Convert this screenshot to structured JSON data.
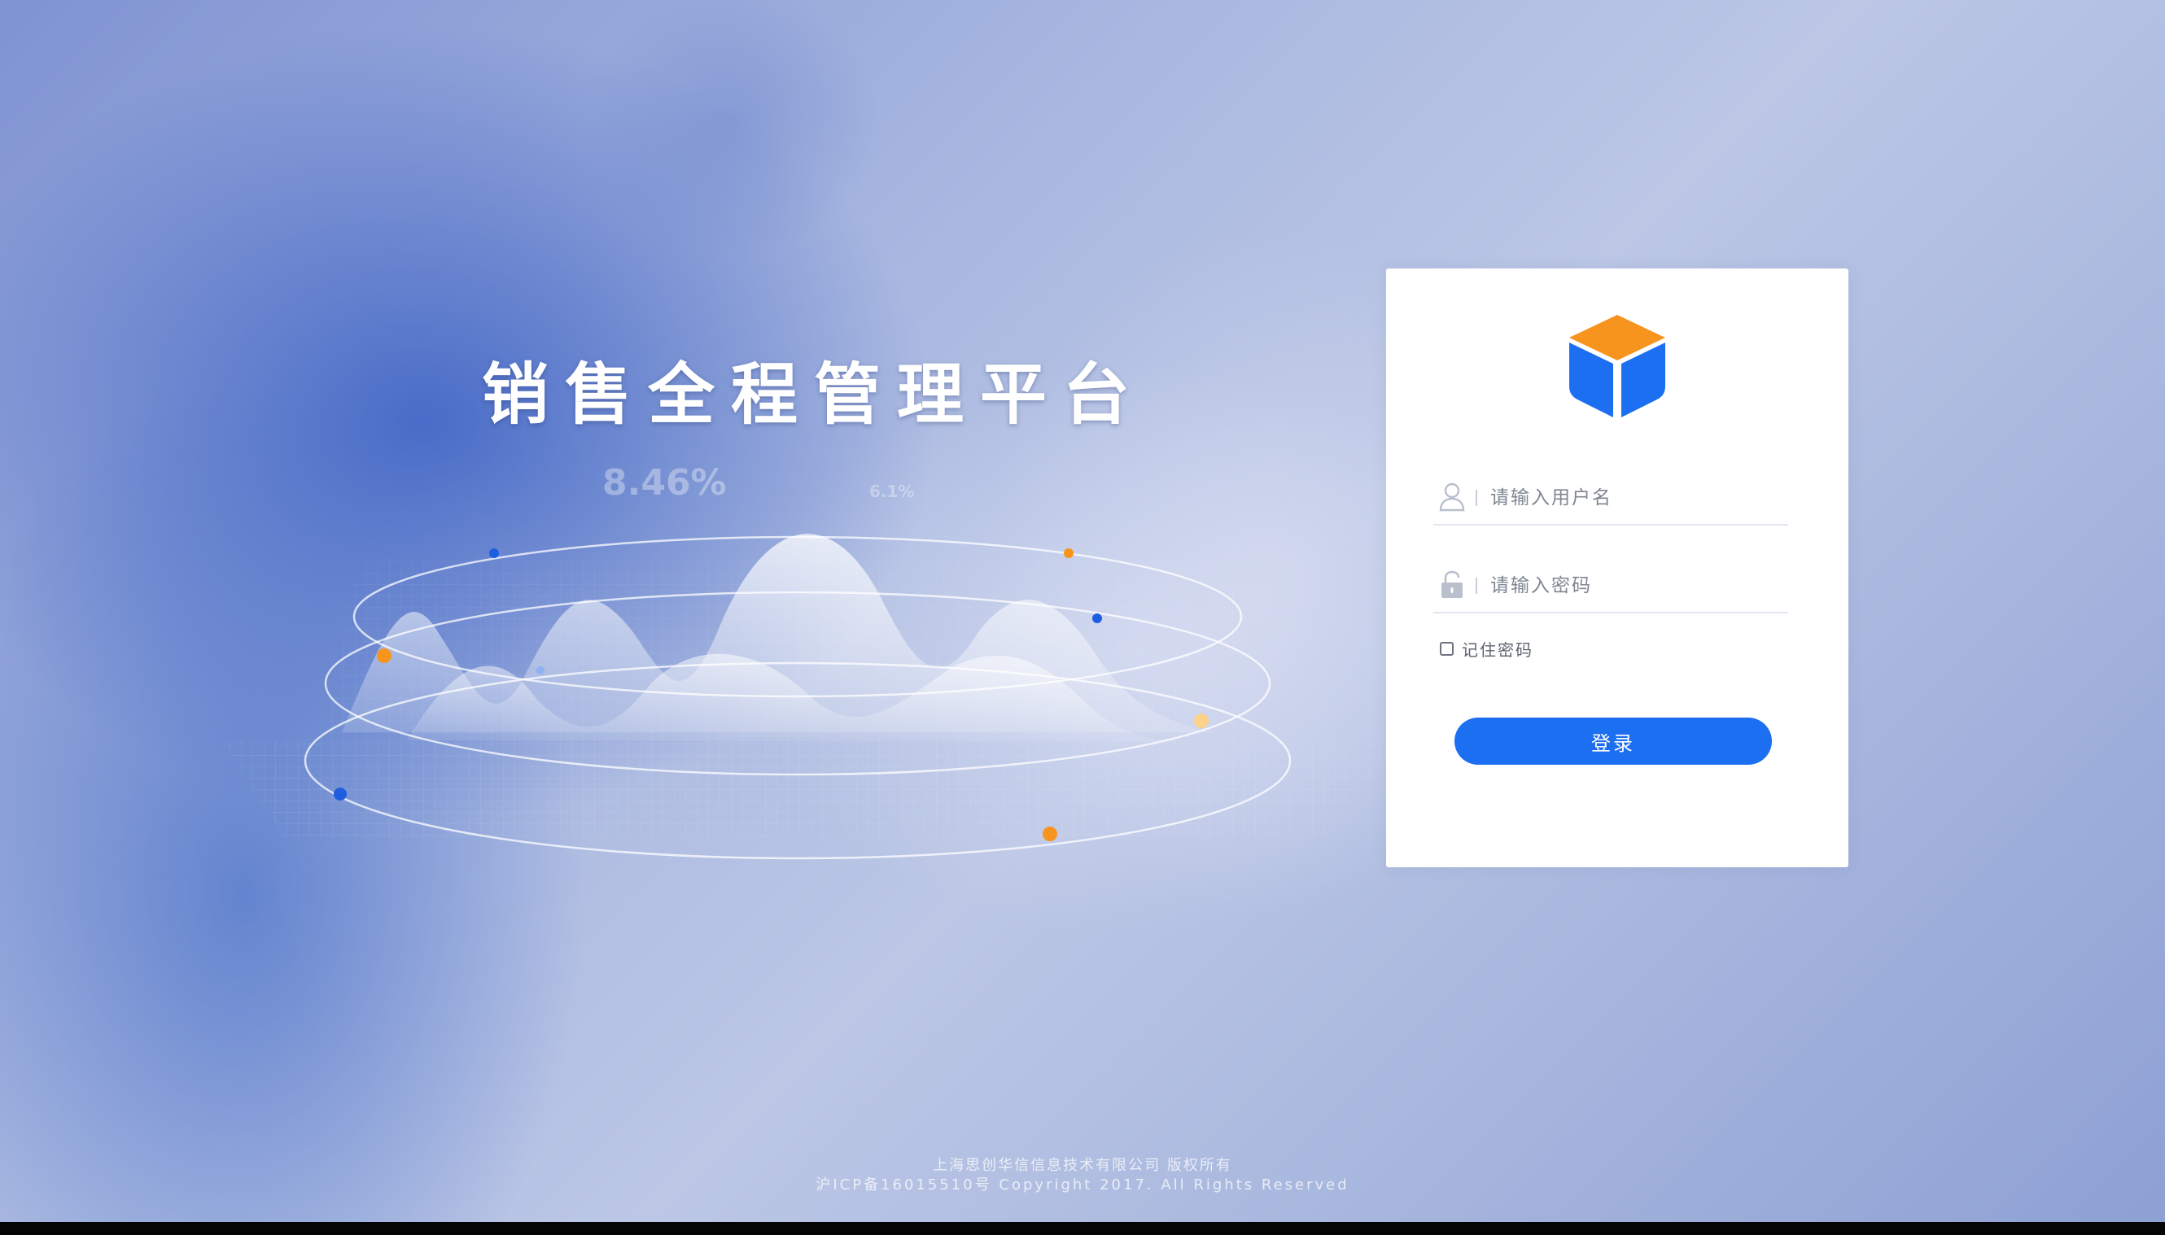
{
  "hero": {
    "title": "销售全程管理平台",
    "stat_percent": "8.46%",
    "stat_small": "6.1%"
  },
  "login": {
    "username_placeholder": "请输入用户名",
    "password_placeholder": "请输入密码",
    "remember_label": "记住密码",
    "remember_checked": false,
    "submit_label": "登录"
  },
  "icons": {
    "logo": "cube-logo-icon",
    "username": "user-icon",
    "password": "lock-icon"
  },
  "colors": {
    "accent": "#1d6ff2",
    "logo_top": "#f7941d",
    "logo_side": "#1d6ff2",
    "chart_dot_orange": "#f7941d",
    "chart_dot_blue": "#1d5fe0"
  },
  "footer": {
    "company": "上海思创华信信息技术有限公司 版权所有",
    "copyright": "沪ICP备16015510号 Copyright 2017. All Rights Reserved"
  }
}
